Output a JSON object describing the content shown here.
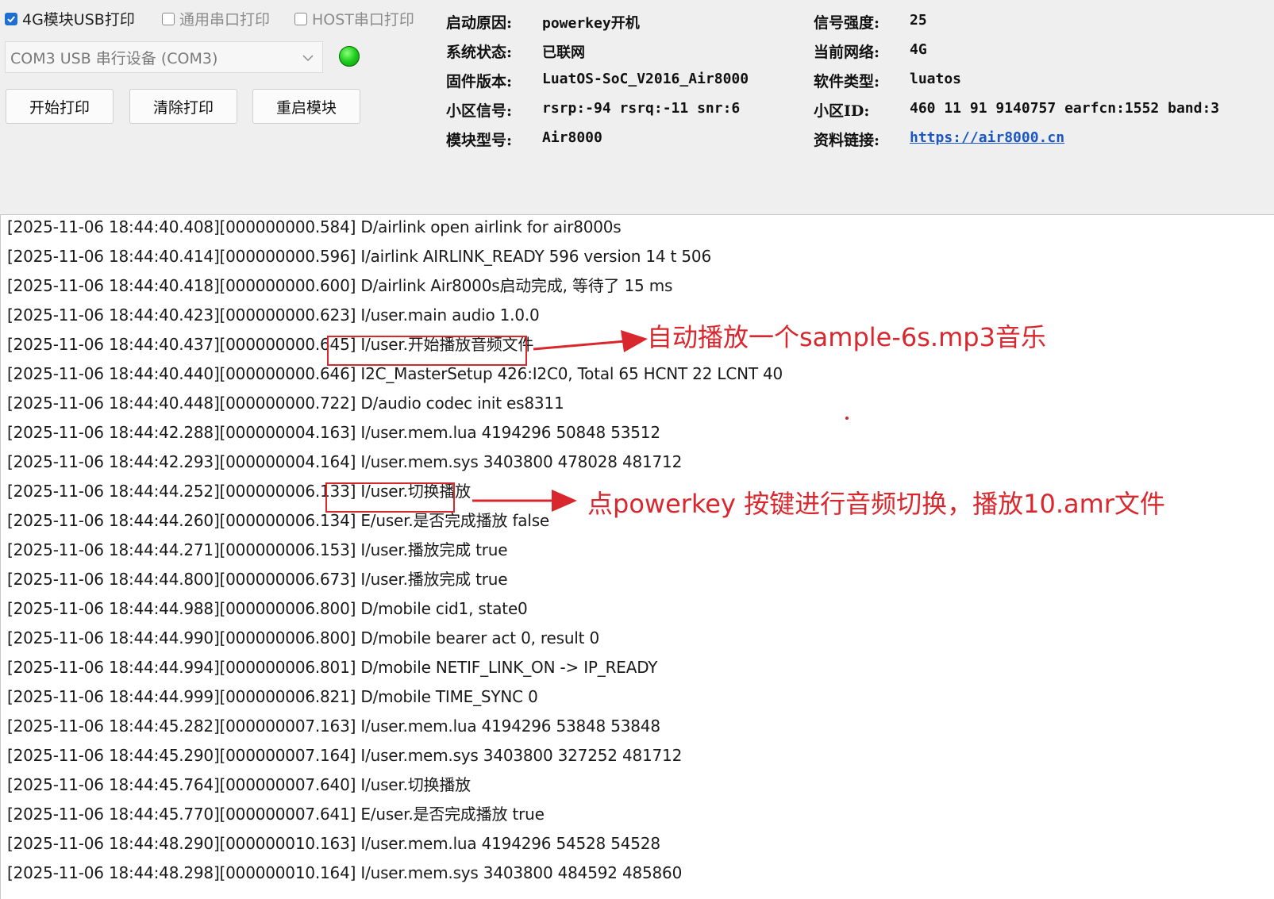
{
  "options": {
    "usb_print": {
      "label": "4G模块USB打印",
      "checked": true
    },
    "uart_print": {
      "label": "通用串口打印",
      "checked": false
    },
    "host_uart_print": {
      "label": "HOST串口打印",
      "checked": false
    }
  },
  "port_select": {
    "value": "COM3 USB 串行设备 (COM3)"
  },
  "status_led_color": "#1fcf1f",
  "buttons": {
    "start": "开始打印",
    "clear": "清除打印",
    "restart": "重启模块"
  },
  "info": {
    "left": [
      {
        "label": "启动原因:",
        "value": "powerkey开机"
      },
      {
        "label": "系统状态:",
        "value": "已联网"
      },
      {
        "label": "固件版本:",
        "value": "LuatOS-SoC_V2016_Air8000"
      },
      {
        "label": "小区信号:",
        "value": "rsrp:-94 rsrq:-11 snr:6"
      },
      {
        "label": "模块型号:",
        "value": "Air8000"
      }
    ],
    "right": [
      {
        "label": "信号强度:",
        "value": "25"
      },
      {
        "label": "当前网络:",
        "value": "4G"
      },
      {
        "label": "软件类型:",
        "value": "luatos"
      },
      {
        "label": "小区ID:",
        "value": "460 11 91 9140757 earfcn:1552 band:3"
      },
      {
        "label": "资料链接:",
        "value": "https://air8000.cn"
      }
    ]
  },
  "log_lines": [
    "[2025-11-06 18:44:40.408][000000000.584] D/airlink open airlink for air8000s",
    "[2025-11-06 18:44:40.414][000000000.596] I/airlink AIRLINK_READY 596 version 14 t 506",
    "[2025-11-06 18:44:40.418][000000000.600] D/airlink Air8000s启动完成, 等待了 15 ms",
    "[2025-11-06 18:44:40.423][000000000.623] I/user.main audio 1.0.0",
    "[2025-11-06 18:44:40.437][000000000.645] I/user.开始播放音频文件",
    "[2025-11-06 18:44:40.440][000000000.646] I2C_MasterSetup 426:I2C0, Total 65 HCNT 22 LCNT 40",
    "[2025-11-06 18:44:40.448][000000000.722] D/audio codec init es8311",
    "[2025-11-06 18:44:42.288][000000004.163] I/user.mem.lua 4194296 50848 53512",
    "[2025-11-06 18:44:42.293][000000004.164] I/user.mem.sys 3403800 478028 481712",
    "[2025-11-06 18:44:44.252][000000006.133] I/user.切换播放",
    "[2025-11-06 18:44:44.260][000000006.134] E/user.是否完成播放 false",
    "[2025-11-06 18:44:44.271][000000006.153] I/user.播放完成 true",
    "[2025-11-06 18:44:44.800][000000006.673] I/user.播放完成 true",
    "[2025-11-06 18:44:44.988][000000006.800] D/mobile cid1, state0",
    "[2025-11-06 18:44:44.990][000000006.800] D/mobile bearer act 0, result 0",
    "[2025-11-06 18:44:44.994][000000006.801] D/mobile NETIF_LINK_ON -> IP_READY",
    "[2025-11-06 18:44:44.999][000000006.821] D/mobile TIME_SYNC 0",
    "[2025-11-06 18:44:45.282][000000007.163] I/user.mem.lua 4194296 53848 53848",
    "[2025-11-06 18:44:45.290][000000007.164] I/user.mem.sys 3403800 327252 481712",
    "[2025-11-06 18:44:45.764][000000007.640] I/user.切换播放",
    "[2025-11-06 18:44:45.770][000000007.641] E/user.是否完成播放 true",
    "[2025-11-06 18:44:48.290][000000010.163] I/user.mem.lua 4194296 54528 54528",
    "[2025-11-06 18:44:48.298][000000010.164] I/user.mem.sys 3403800 484592 485860"
  ],
  "annotations": {
    "first": "自动播放一个sample-6s.mp3音乐",
    "second": "点powerkey 按键进行音频切换，播放10.amr文件",
    "color": "#d9272e"
  }
}
